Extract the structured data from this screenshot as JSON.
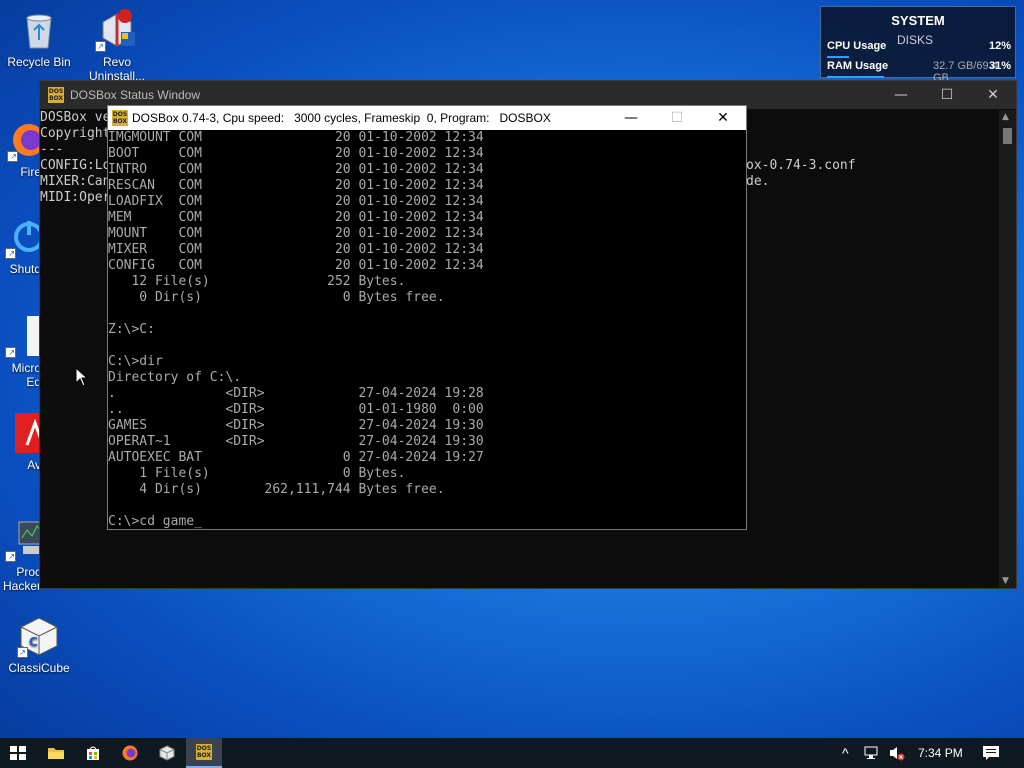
{
  "desktop": {
    "icons": [
      {
        "label": "Recycle Bin",
        "icon": "recycle-bin-icon"
      },
      {
        "label": "Revo Uninstall...",
        "icon": "revo-uninstaller-icon"
      },
      {
        "label": "Fire",
        "icon": "firefox-icon"
      },
      {
        "label": "Shutd",
        "icon": "shutdown-icon"
      },
      {
        "label": "Micro Ed",
        "icon": "edge-icon"
      },
      {
        "label": "Av",
        "icon": "avira-icon"
      },
      {
        "label": "Proc Hacker",
        "icon": "process-hacker-icon"
      },
      {
        "label": "ClassiCube",
        "icon": "classicube-icon"
      }
    ]
  },
  "sysmon": {
    "title": "SYSTEM",
    "disks_label": "DISKS",
    "cpu": {
      "label": "CPU Usage",
      "value": "12%",
      "fraction": 0.12
    },
    "ram": {
      "label": "RAM Usage",
      "detail": "32.7 GB/69.4 GB",
      "value": "31%",
      "fraction": 0.31
    }
  },
  "status_window": {
    "title": "DOSBox Status Window",
    "lines": [
      "DOSBox ve",
      "Copyright",
      "---",
      "CONFIG:Lo",
      "MIXER:Can",
      "MIDI:Oper"
    ],
    "right_lines": [
      "ox-0.74-3.conf",
      "de."
    ]
  },
  "dosbox_window": {
    "title": "DOSBox 0.74-3, Cpu speed:   3000 cycles, Frameskip  0, Program:   DOSBOX",
    "screen_lines": [
      "IMGMOUNT COM                 20 01-10-2002 12:34",
      "BOOT     COM                 20 01-10-2002 12:34",
      "INTRO    COM                 20 01-10-2002 12:34",
      "RESCAN   COM                 20 01-10-2002 12:34",
      "LOADFIX  COM                 20 01-10-2002 12:34",
      "MEM      COM                 20 01-10-2002 12:34",
      "MOUNT    COM                 20 01-10-2002 12:34",
      "MIXER    COM                 20 01-10-2002 12:34",
      "CONFIG   COM                 20 01-10-2002 12:34",
      "   12 File(s)               252 Bytes.",
      "    0 Dir(s)                  0 Bytes free.",
      "",
      "Z:\\>C:",
      "",
      "C:\\>dir",
      "Directory of C:\\.",
      ".              <DIR>            27-04-2024 19:28",
      "..             <DIR>            01-01-1980  0:00",
      "GAMES          <DIR>            27-04-2024 19:30",
      "OPERAT~1       <DIR>            27-04-2024 19:30",
      "AUTOEXEC BAT                  0 27-04-2024 19:27",
      "    1 File(s)                 0 Bytes.",
      "    4 Dir(s)        262,111,744 Bytes free.",
      "",
      "C:\\>cd game_"
    ]
  },
  "window_controls": {
    "minimize": "—",
    "maximize": "☐",
    "close": "✕"
  },
  "taskbar": {
    "items": [
      {
        "name": "start",
        "icon": "windows-start-icon"
      },
      {
        "name": "file-explorer",
        "icon": "folder-icon"
      },
      {
        "name": "store",
        "icon": "store-icon"
      },
      {
        "name": "firefox",
        "icon": "firefox-icon"
      },
      {
        "name": "app",
        "icon": "cube-app-icon"
      },
      {
        "name": "dosbox",
        "icon": "dosbox-icon",
        "active": true
      }
    ],
    "time": "7:34 PM",
    "tray_chevron": "^"
  },
  "colors": {
    "accent": "#1a78dc",
    "dos_text": "#aaaaaa",
    "console_bg": "#0c0c0c"
  }
}
